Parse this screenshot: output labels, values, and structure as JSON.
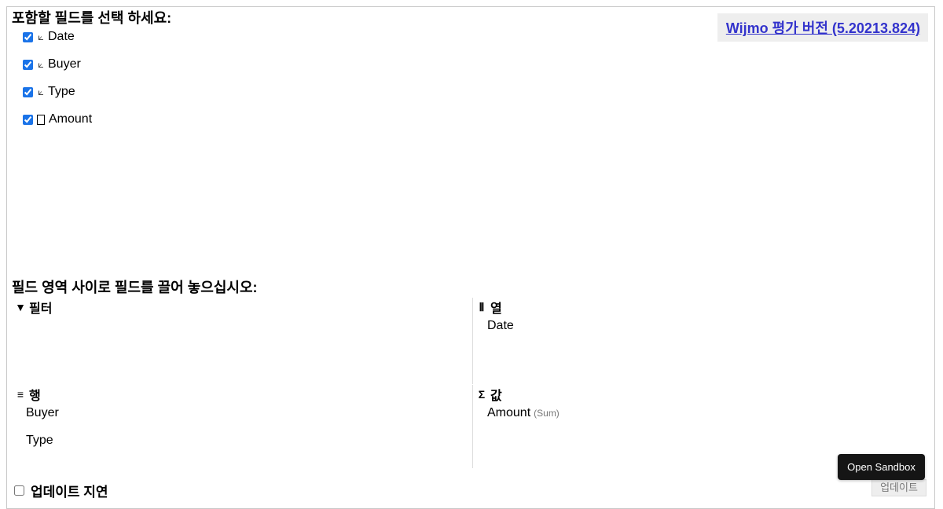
{
  "header": {
    "fields_heading": "포함할 필드를 선택 하세요:",
    "version_link": "Wijmo 평가 버전 (5.20213.824)"
  },
  "fields": [
    {
      "glyph": "⟀",
      "label": "Date",
      "checked": true
    },
    {
      "glyph": "⟀",
      "label": "Buyer",
      "checked": true
    },
    {
      "glyph": "⟀",
      "label": "Type",
      "checked": true
    },
    {
      "glyph": "box",
      "label": "Amount",
      "checked": true
    }
  ],
  "areas_heading": "필드 영역 사이로 필드를 끌어 놓으십시오:",
  "areas": {
    "filters": {
      "icon": "▼",
      "title": "필터",
      "items": []
    },
    "columns": {
      "icon": "⦀",
      "title": "열",
      "items": [
        {
          "label": "Date",
          "agg": ""
        }
      ]
    },
    "rows": {
      "icon": "≡",
      "title": "행",
      "items": [
        {
          "label": "Buyer",
          "agg": ""
        },
        {
          "label": "Type",
          "agg": ""
        }
      ]
    },
    "values": {
      "icon": "Σ",
      "title": "값",
      "items": [
        {
          "label": "Amount",
          "agg": "(Sum)"
        }
      ]
    }
  },
  "footer": {
    "defer_label": "업데이트 지연",
    "defer_checked": false,
    "update_label": "업데이트",
    "sandbox_label": "Open Sandbox"
  }
}
